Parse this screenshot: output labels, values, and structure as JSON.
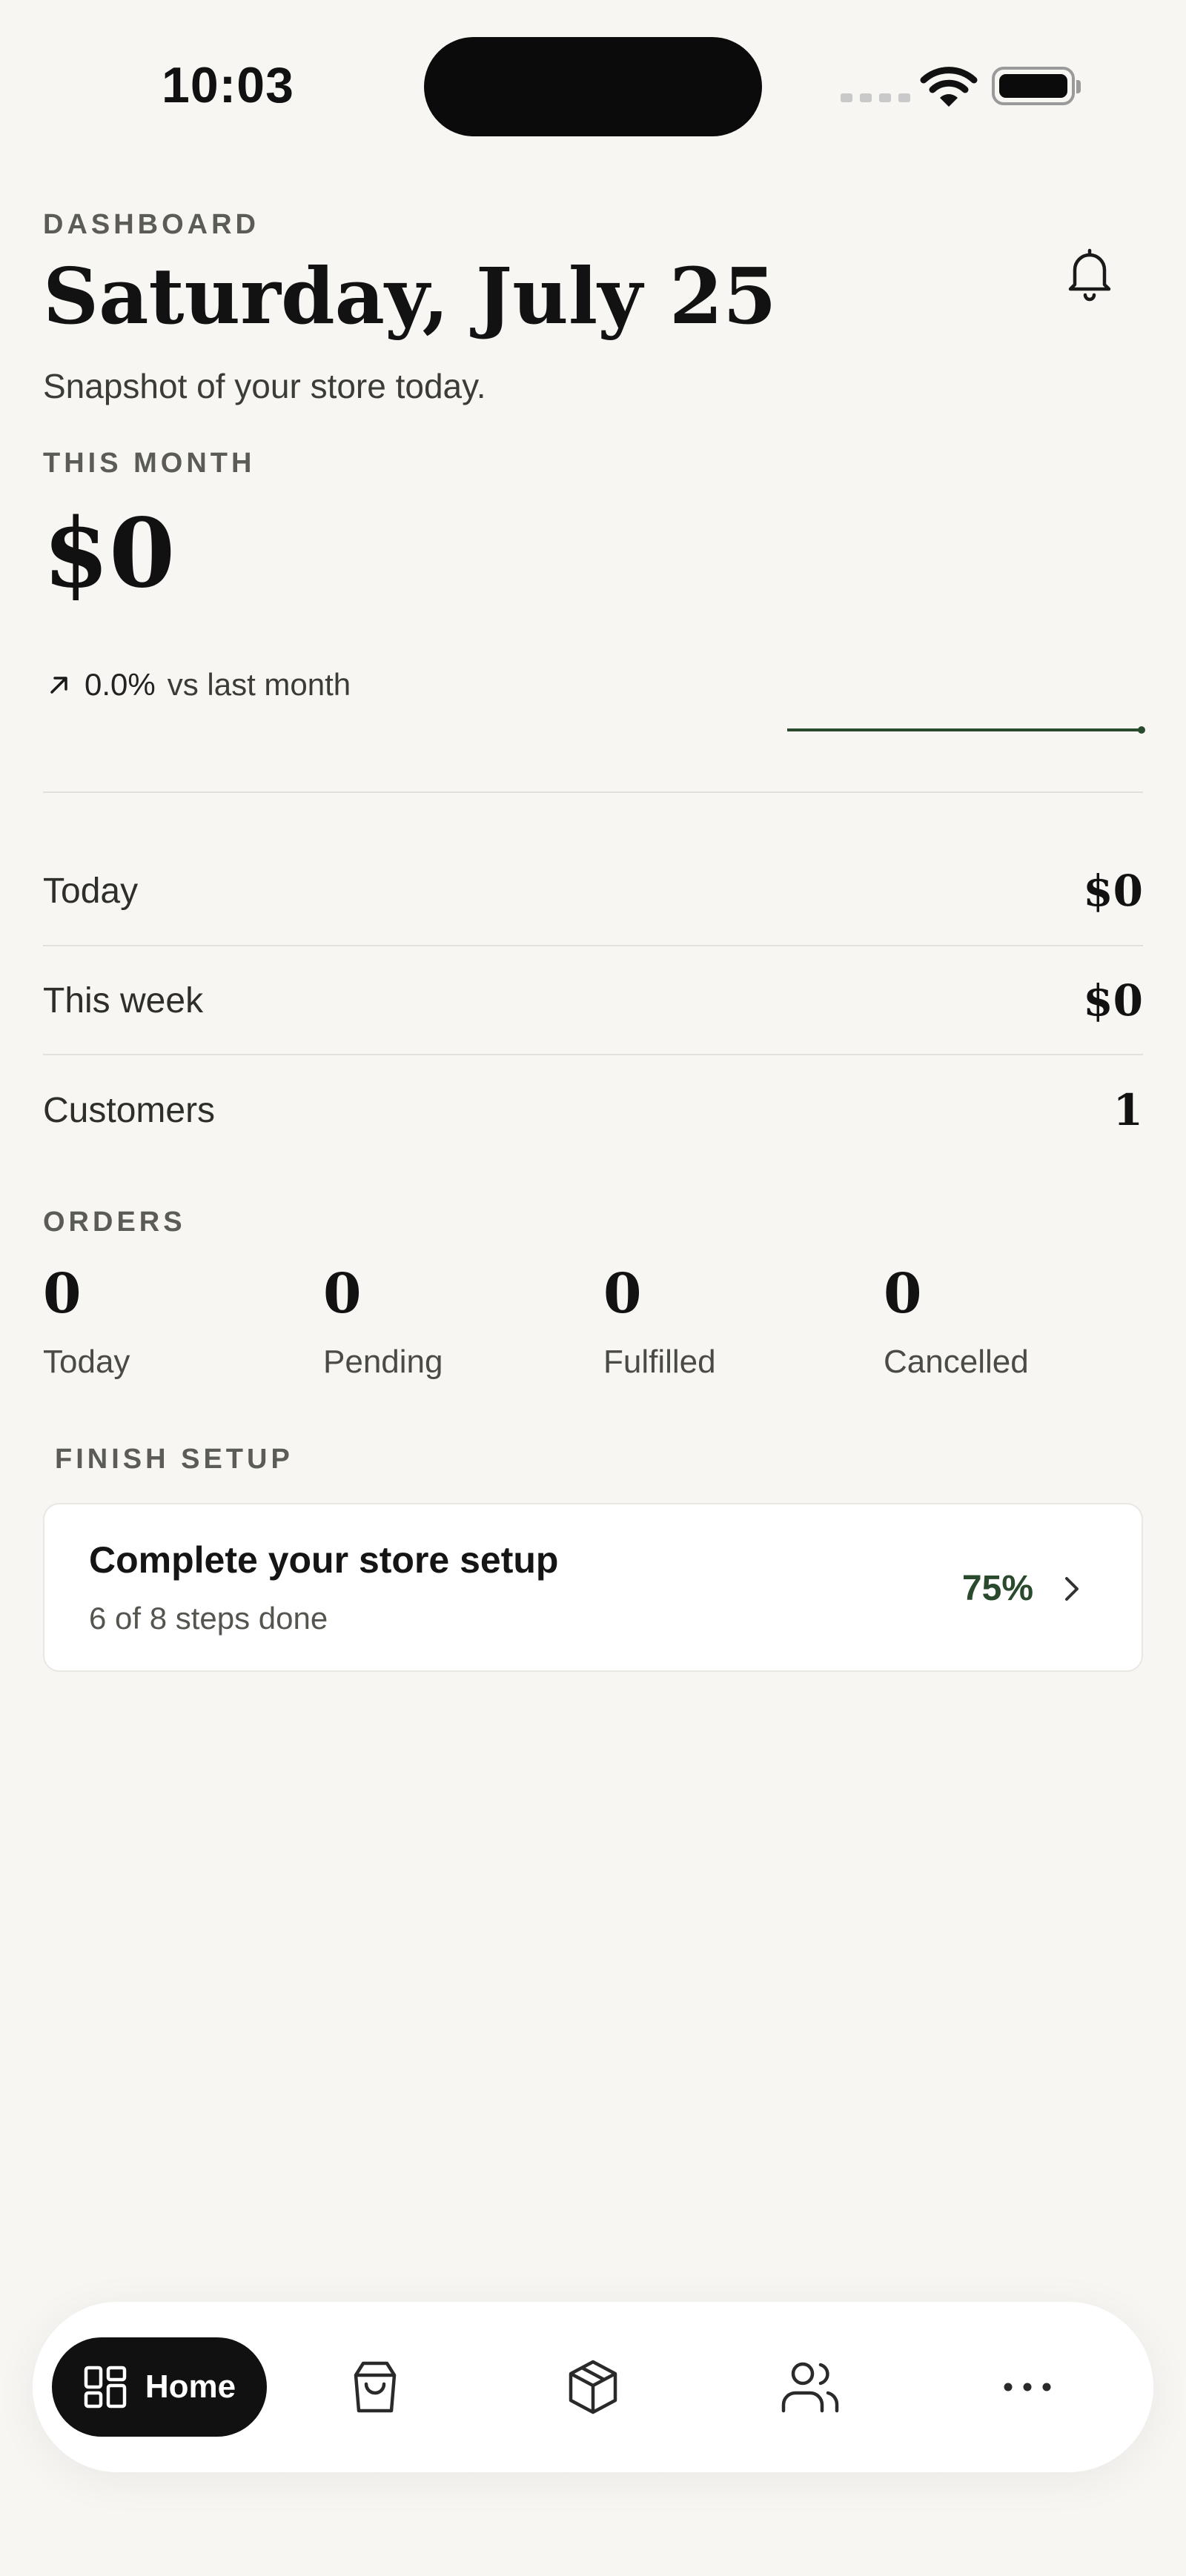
{
  "status_bar": {
    "time": "10:03"
  },
  "header": {
    "eyebrow": "DASHBOARD",
    "title": "Saturday, July 25",
    "subtitle": "Snapshot of your store today.",
    "notification_icon": "bell-icon"
  },
  "this_month": {
    "label": "THIS MONTH",
    "value": "$0",
    "change_percent": "0.0%",
    "change_label": "vs last month",
    "trend_icon": "arrow-up-right-icon",
    "sparkline_values": [
      0,
      0,
      0,
      0,
      0,
      0,
      0,
      0
    ],
    "accent_color": "#2a4a2e"
  },
  "stats": [
    {
      "label": "Today",
      "value": "$0"
    },
    {
      "label": "This week",
      "value": "$0"
    },
    {
      "label": "Customers",
      "value": "1"
    }
  ],
  "orders": {
    "label": "ORDERS",
    "items": [
      {
        "value": "0",
        "label": "Today"
      },
      {
        "value": "0",
        "label": "Pending"
      },
      {
        "value": "0",
        "label": "Fulfilled"
      },
      {
        "value": "0",
        "label": "Cancelled"
      }
    ]
  },
  "setup": {
    "section_label": "FINISH SETUP",
    "title": "Complete your store setup",
    "subtitle": "6 of 8 steps done",
    "percent": "75%",
    "progress_fraction": 0.75
  },
  "bottom_nav": {
    "items": [
      {
        "label": "Home",
        "icon": "grid-icon",
        "active": true
      },
      {
        "label": "",
        "icon": "shopping-bag-icon",
        "active": false
      },
      {
        "label": "",
        "icon": "box-icon",
        "active": false
      },
      {
        "label": "",
        "icon": "users-icon",
        "active": false
      },
      {
        "label": "",
        "icon": "more-icon",
        "active": false
      }
    ]
  }
}
